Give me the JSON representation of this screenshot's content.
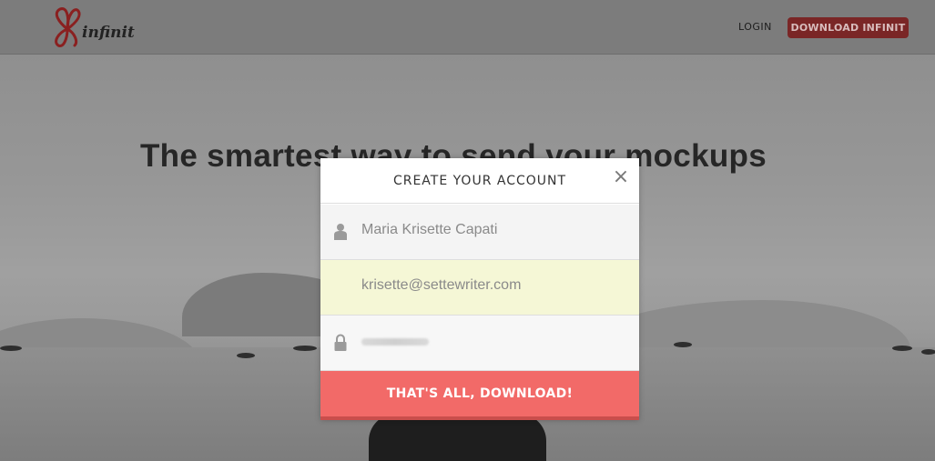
{
  "header": {
    "logo_text": "infinit",
    "login_label": "LOGIN",
    "download_label": "DOWNLOAD INFINIT"
  },
  "hero": {
    "headline": "The smartest way to send your mockups"
  },
  "modal": {
    "title": "CREATE YOUR ACCOUNT",
    "close_icon": "×",
    "name_value": "Maria Krisette Capati",
    "email_value": "krisette@settewriter.com",
    "submit_label": "THAT'S ALL, DOWNLOAD!"
  },
  "icons": {
    "logo": "infinit-logo",
    "close": "close-icon",
    "user": "user-icon",
    "lock": "lock-icon"
  },
  "colors": {
    "brand_red": "#f26a68",
    "header_button_bg": "#7a2626",
    "email_highlight": "#f5f7d6"
  }
}
